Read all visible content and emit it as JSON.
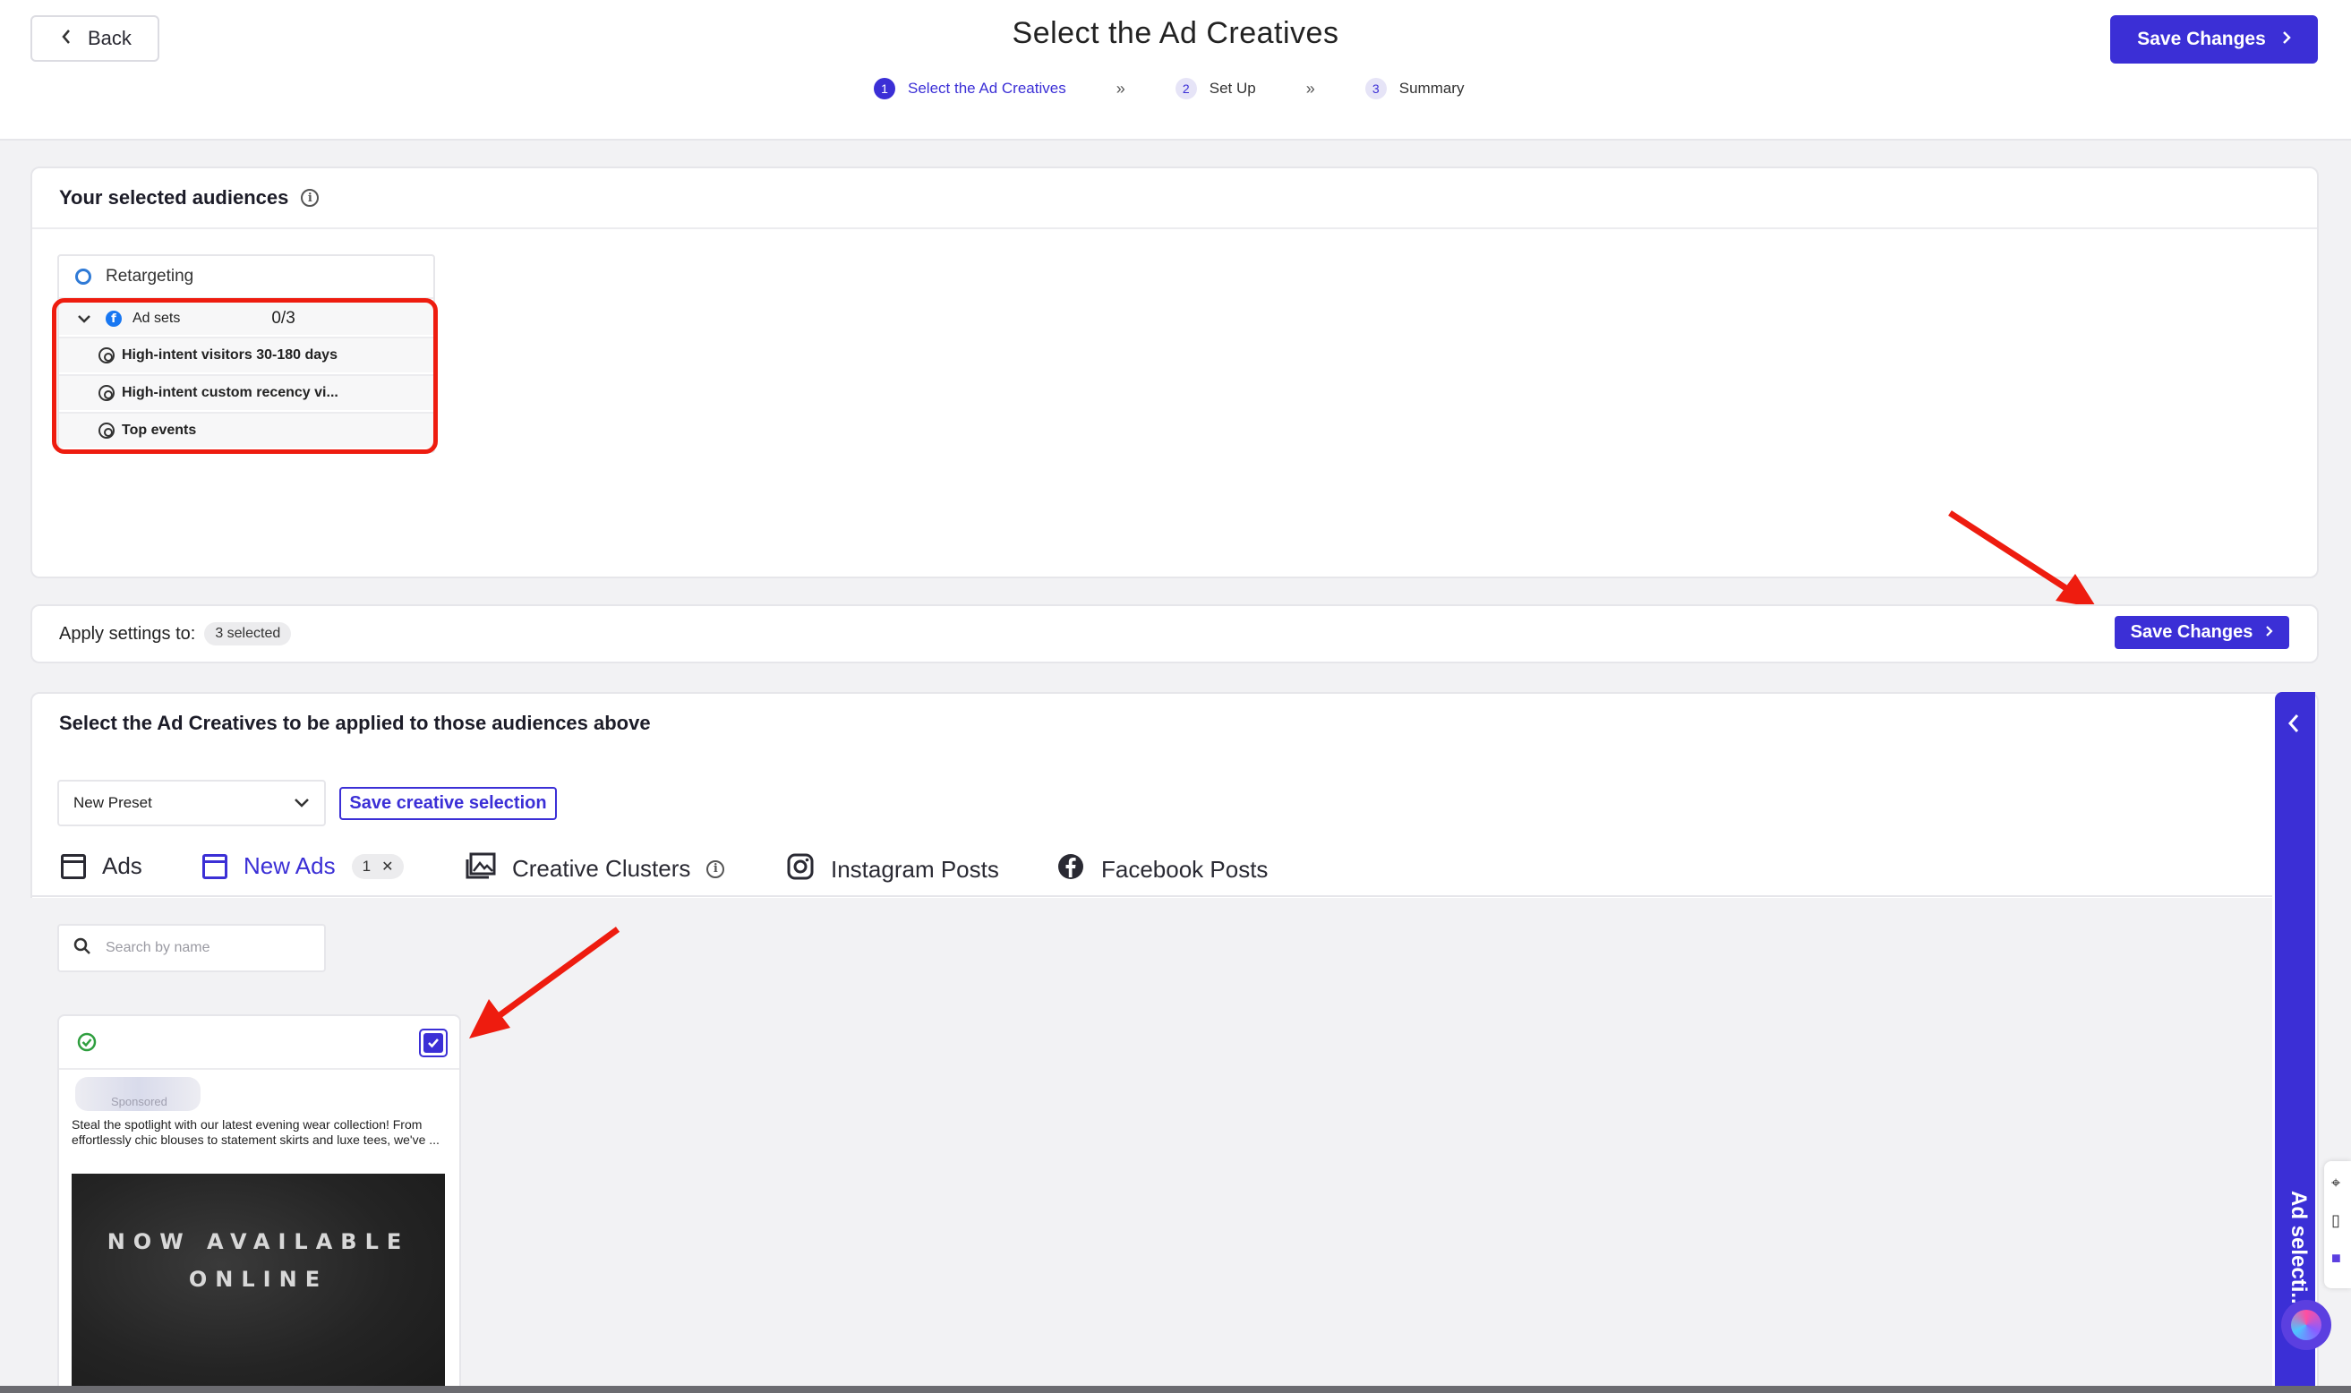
{
  "header": {
    "back_label": "Back",
    "title": "Select the Ad Creatives",
    "steps": [
      {
        "num": "1",
        "label": "Select the Ad Creatives",
        "active": true
      },
      {
        "num": "2",
        "label": "Set Up",
        "active": false
      },
      {
        "num": "3",
        "label": "Summary",
        "active": false
      }
    ],
    "step_separator": "»",
    "save_label": "Save Changes"
  },
  "audiences": {
    "title": "Your selected audiences",
    "group_name": "Retargeting",
    "adsets_label": "Ad sets",
    "adsets_count": "0/3",
    "items": [
      "High-intent visitors 30-180 days",
      "High-intent custom recency vi...",
      "Top events"
    ]
  },
  "apply": {
    "label": "Apply settings to:",
    "selected": "3 selected",
    "save_label": "Save Changes"
  },
  "creatives": {
    "title": "Select the Ad Creatives to be applied to those audiences above",
    "preset_value": "New Preset",
    "save_selection_label": "Save creative selection",
    "tabs": [
      {
        "label": "Ads",
        "icon": "ad-frame-icon"
      },
      {
        "label": "New Ads",
        "icon": "ad-frame-icon",
        "count": "1",
        "active": true
      },
      {
        "label": "Creative Clusters",
        "icon": "image-gallery-icon"
      },
      {
        "label": "Instagram Posts",
        "icon": "instagram-icon"
      },
      {
        "label": "Facebook Posts",
        "icon": "facebook-icon"
      }
    ],
    "search_placeholder": "Search by name",
    "card": {
      "sponsored": "Sponsored",
      "text": "Steal the spotlight with our latest evening wear collection! From effortlessly chic blouses to statement skirts and luxe tees, we've ...",
      "image_line1": "NOW AVAILABLE",
      "image_line2": "ONLINE",
      "checked": true
    }
  },
  "drawer": {
    "label": "Ad selecti... evi"
  },
  "colors": {
    "accent": "#3b2fd6",
    "annotation_red": "#ee1c0f",
    "background": "#f2f2f4"
  }
}
